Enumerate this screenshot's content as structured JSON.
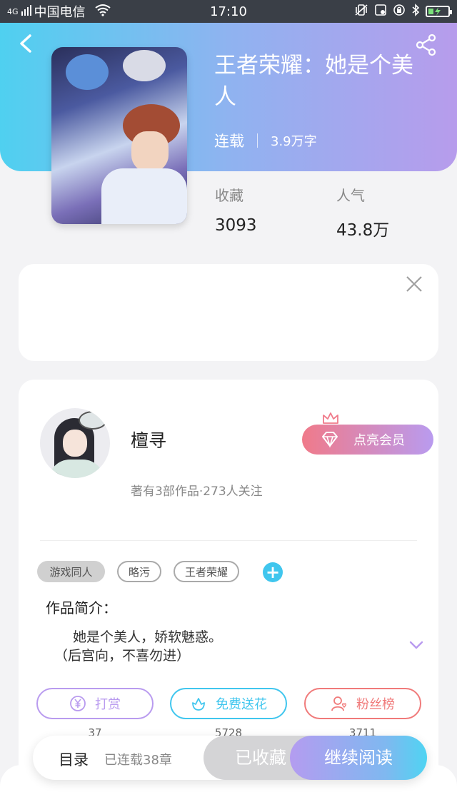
{
  "status_bar": {
    "carrier": "中国电信",
    "network": "4G",
    "time": "17:10"
  },
  "book": {
    "title": "王者荣耀：她是个美人",
    "status": "连载",
    "word_count": "3.9万字",
    "stats": [
      {
        "label": "收藏",
        "value": "3093"
      },
      {
        "label": "人气",
        "value": "43.8万"
      }
    ]
  },
  "author": {
    "name": "檀寻",
    "meta": "著有3部作品·273人关注",
    "member_button": "点亮会员"
  },
  "tags": [
    "游戏同人",
    "略污",
    "王者荣耀"
  ],
  "intro": {
    "title": "作品简介：",
    "line1": "她是个美人，娇软魅惑。",
    "line2": "（后宫向，不喜勿进）"
  },
  "actions": [
    {
      "label": "打赏",
      "count": "37",
      "color": "#b99bef",
      "icon": "yen-icon"
    },
    {
      "label": "免费送花",
      "count": "5728",
      "color": "#40c6ee",
      "icon": "flower-icon"
    },
    {
      "label": "粉丝榜",
      "count": "3711",
      "color": "#f07a7a",
      "icon": "fan-rank-icon"
    }
  ],
  "bottom_bar": {
    "toc_label": "目录",
    "toc_count": "已连载38章",
    "collected": "已收藏",
    "continue_read": "继续阅读"
  },
  "colors": {
    "header_gradient_start": "#4fd0f0",
    "header_gradient_end": "#b79cec",
    "accent_blue": "#40c6ee",
    "member_pink": "#f07a8a"
  }
}
